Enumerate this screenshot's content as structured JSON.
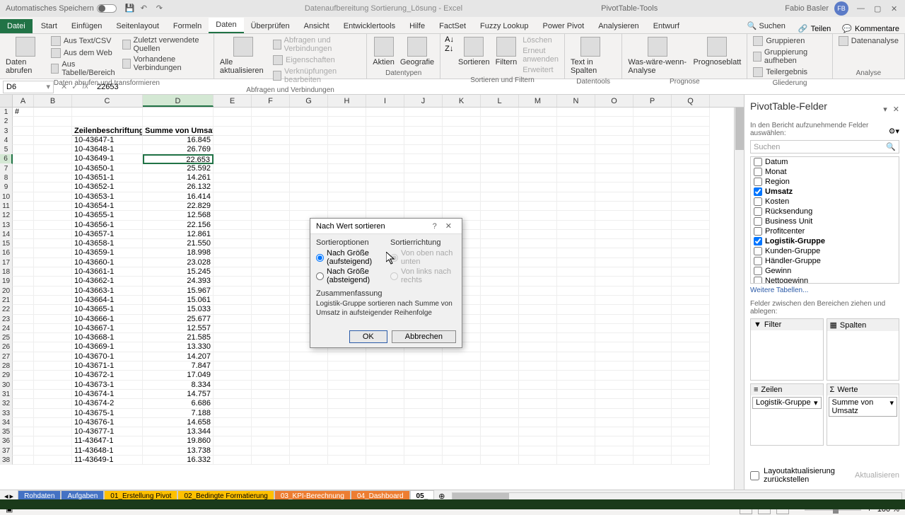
{
  "titlebar": {
    "autosave": "Automatisches Speichern",
    "filename": "Datenaufbereitung Sortierung_Lösung",
    "app": "Excel",
    "toolgroup": "PivotTable-Tools",
    "username": "Fabio Basler",
    "initials": "FB"
  },
  "tabs": {
    "file": "Datei",
    "start": "Start",
    "einfuegen": "Einfügen",
    "seitenlayout": "Seitenlayout",
    "formeln": "Formeln",
    "daten": "Daten",
    "ueberpruefen": "Überprüfen",
    "ansicht": "Ansicht",
    "entwickler": "Entwicklertools",
    "hilfe": "Hilfe",
    "factset": "FactSet",
    "fuzzy": "Fuzzy Lookup",
    "powerpivot": "Power Pivot",
    "analysieren": "Analysieren",
    "entwurf": "Entwurf",
    "suchen": "Suchen",
    "teilen": "Teilen",
    "kommentare": "Kommentare"
  },
  "ribbon": {
    "g1": "Daten abrufen und transformieren",
    "g1_items": [
      "Aus Text/CSV",
      "Aus dem Web",
      "Aus Tabelle/Bereich",
      "Zuletzt verwendete Quellen",
      "Vorhandene Verbindungen"
    ],
    "g1_main": "Daten abrufen",
    "g2": "Abfragen und Verbindungen",
    "g2_main": "Alle aktualisieren",
    "g2_items": [
      "Abfragen und Verbindungen",
      "Eigenschaften",
      "Verknüpfungen bearbeiten"
    ],
    "g3": "Datentypen",
    "g3_items": [
      "Aktien",
      "Geografie"
    ],
    "g4": "Sortieren und Filtern",
    "g4_items": [
      "Sortieren",
      "Filtern",
      "Löschen",
      "Erneut anwenden",
      "Erweitert"
    ],
    "g5": "Datentools",
    "g5_main": "Text in Spalten",
    "g6": "Prognose",
    "g6_items": [
      "Was-wäre-wenn-Analyse",
      "Prognoseblatt"
    ],
    "g7": "Gliederung",
    "g7_items": [
      "Gruppieren",
      "Gruppierung aufheben",
      "Teilergebnis"
    ],
    "g8": "Analyse",
    "g8_main": "Datenanalyse"
  },
  "formula": {
    "cellref": "D6",
    "value": "22653"
  },
  "columns": [
    "A",
    "B",
    "C",
    "D",
    "E",
    "F",
    "G",
    "H",
    "I",
    "J",
    "K",
    "L",
    "M",
    "N",
    "O",
    "P",
    "Q"
  ],
  "table": {
    "hdr_c": "Zeilenbeschriftungen",
    "hdr_d": "Summe von Umsatz",
    "row1_a": "#",
    "rows": [
      {
        "c": "10-43647-1",
        "d": "16.845"
      },
      {
        "c": "10-43648-1",
        "d": "26.769"
      },
      {
        "c": "10-43649-1",
        "d": "22.653"
      },
      {
        "c": "10-43650-1",
        "d": "25.592"
      },
      {
        "c": "10-43651-1",
        "d": "14.261"
      },
      {
        "c": "10-43652-1",
        "d": "26.132"
      },
      {
        "c": "10-43653-1",
        "d": "16.414"
      },
      {
        "c": "10-43654-1",
        "d": "22.829"
      },
      {
        "c": "10-43655-1",
        "d": "12.568"
      },
      {
        "c": "10-43656-1",
        "d": "22.156"
      },
      {
        "c": "10-43657-1",
        "d": "12.861"
      },
      {
        "c": "10-43658-1",
        "d": "21.550"
      },
      {
        "c": "10-43659-1",
        "d": "18.998"
      },
      {
        "c": "10-43660-1",
        "d": "23.028"
      },
      {
        "c": "10-43661-1",
        "d": "15.245"
      },
      {
        "c": "10-43662-1",
        "d": "24.393"
      },
      {
        "c": "10-43663-1",
        "d": "15.967"
      },
      {
        "c": "10-43664-1",
        "d": "15.061"
      },
      {
        "c": "10-43665-1",
        "d": "15.033"
      },
      {
        "c": "10-43666-1",
        "d": "25.677"
      },
      {
        "c": "10-43667-1",
        "d": "12.557"
      },
      {
        "c": "10-43668-1",
        "d": "21.585"
      },
      {
        "c": "10-43669-1",
        "d": "13.330"
      },
      {
        "c": "10-43670-1",
        "d": "14.207"
      },
      {
        "c": "10-43671-1",
        "d": "7.847"
      },
      {
        "c": "10-43672-1",
        "d": "17.049"
      },
      {
        "c": "10-43673-1",
        "d": "8.334"
      },
      {
        "c": "10-43674-1",
        "d": "14.757"
      },
      {
        "c": "10-43674-2",
        "d": "6.686"
      },
      {
        "c": "10-43675-1",
        "d": "7.188"
      },
      {
        "c": "10-43676-1",
        "d": "14.658"
      },
      {
        "c": "10-43677-1",
        "d": "13.344"
      },
      {
        "c": "11-43647-1",
        "d": "19.860"
      },
      {
        "c": "11-43648-1",
        "d": "13.738"
      },
      {
        "c": "11-43649-1",
        "d": "16.332"
      }
    ]
  },
  "pivot": {
    "title": "PivotTable-Felder",
    "desc": "In den Bericht aufzunehmende Felder auswählen:",
    "search": "Suchen",
    "fields": [
      {
        "name": "Datum",
        "checked": false
      },
      {
        "name": "Monat",
        "checked": false
      },
      {
        "name": "Region",
        "checked": false
      },
      {
        "name": "Umsatz",
        "checked": true
      },
      {
        "name": "Kosten",
        "checked": false
      },
      {
        "name": "Rücksendung",
        "checked": false
      },
      {
        "name": "Business Unit",
        "checked": false
      },
      {
        "name": "Profitcenter",
        "checked": false
      },
      {
        "name": "Logistik-Gruppe",
        "checked": true
      },
      {
        "name": "Kunden-Gruppe",
        "checked": false
      },
      {
        "name": "Händler-Gruppe",
        "checked": false
      },
      {
        "name": "Gewinn",
        "checked": false
      },
      {
        "name": "Nettogewinn",
        "checked": false
      }
    ],
    "more": "Weitere Tabellen...",
    "areadesc": "Felder zwischen den Bereichen ziehen und ablegen:",
    "filter": "Filter",
    "spalten": "Spalten",
    "zeilen": "Zeilen",
    "werte": "Werte",
    "zeilen_item": "Logistik-Gruppe",
    "werte_item": "Summe von Umsatz",
    "defer": "Layoutaktualisierung zurückstellen",
    "update": "Aktualisieren"
  },
  "dialog": {
    "title": "Nach Wert sortieren",
    "sortopt": "Sortieroptionen",
    "sortdir": "Sortierrichtung",
    "asc": "Nach Größe (aufsteigend)",
    "desc": "Nach Größe (absteigend)",
    "topdown": "Von oben nach unten",
    "leftright": "Von links nach rechts",
    "summary_label": "Zusammenfassung",
    "summary": "Logistik-Gruppe sortieren nach Summe von Umsatz in aufsteigender Reihenfolge",
    "ok": "OK",
    "cancel": "Abbrechen"
  },
  "sheets": {
    "tabs": [
      "Rohdaten",
      "Aufgaben",
      "01_Erstellung Pivot",
      "02_Bedingte Formatierung",
      "03_KPI-Berechnung",
      "04_Dashboard",
      "05_"
    ]
  },
  "status": {
    "zoom": "100 %"
  }
}
